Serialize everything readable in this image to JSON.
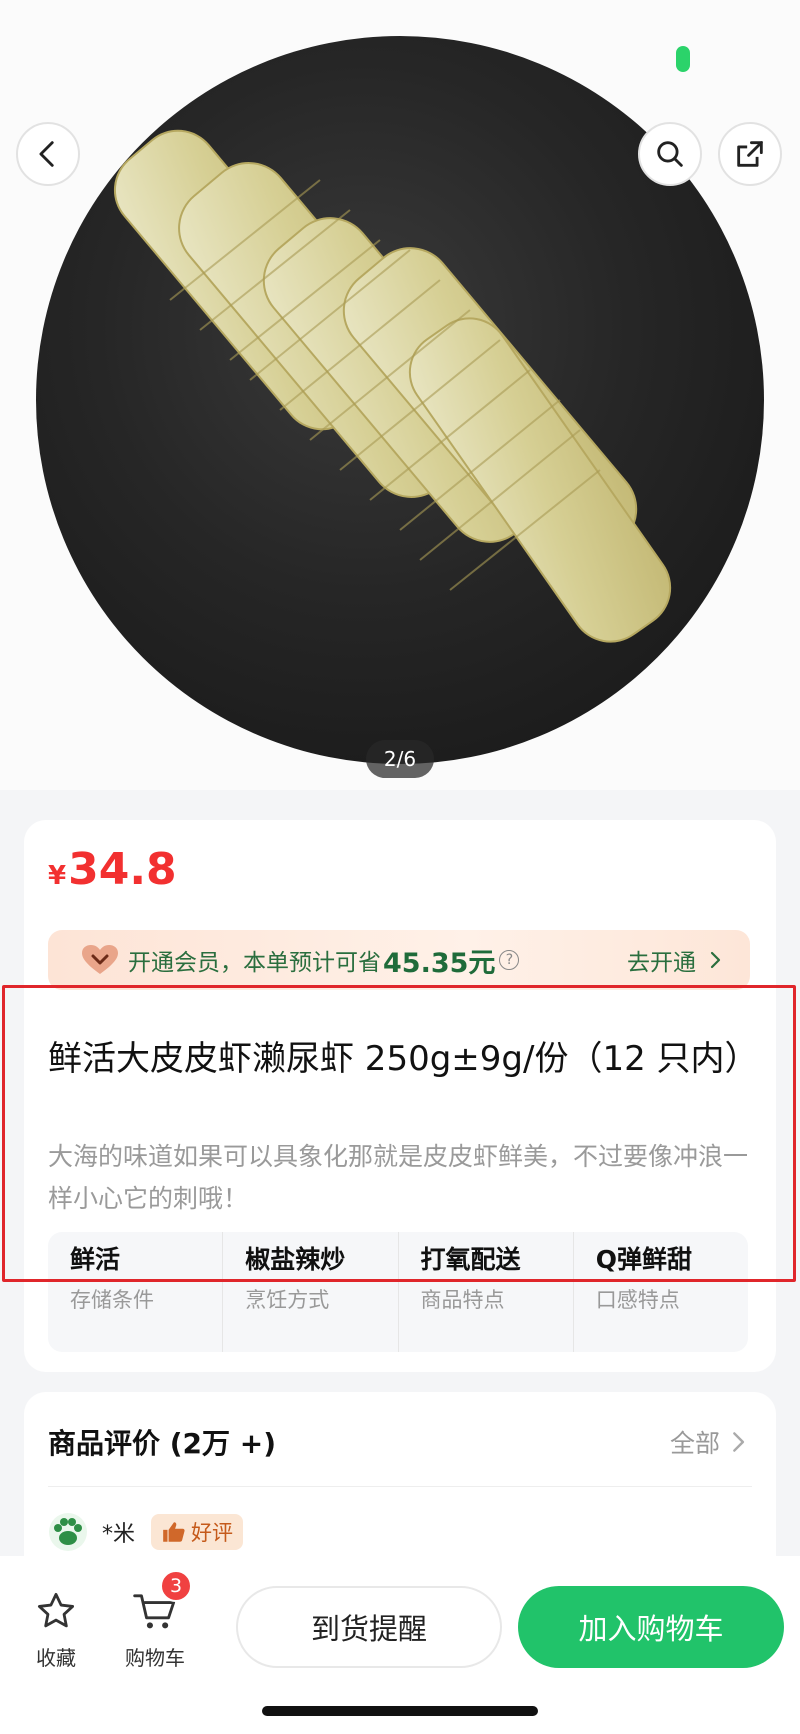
{
  "image": {
    "pager": "2/6"
  },
  "price": {
    "currency": "¥",
    "value": "34.8"
  },
  "member_banner": {
    "text": "开通会员，本单预计可省",
    "amount": "45.35元",
    "cta": "去开通"
  },
  "product": {
    "title": "鲜活大皮皮虾濑尿虾 250g±9g/份（12 只内）",
    "description": "大海的味道如果可以具象化那就是皮皮虾鲜美，不过要像冲浪一样小心它的刺哦！",
    "attributes": [
      {
        "value": "鲜活",
        "label": "存储条件"
      },
      {
        "value": "椒盐辣炒",
        "label": "烹饪方式"
      },
      {
        "value": "打氧配送",
        "label": "商品特点"
      },
      {
        "value": "Q弹鲜甜",
        "label": "口感特点"
      }
    ]
  },
  "reviews": {
    "title": "商品评价 (2万 +)",
    "all_label": "全部",
    "first": {
      "user": "*米",
      "badge": "好评"
    }
  },
  "bottom_bar": {
    "favorite_label": "收藏",
    "cart_label": "购物车",
    "cart_count": "3",
    "remind_label": "到货提醒",
    "add_cart_label": "加入购物车"
  },
  "colors": {
    "price": "#f23030",
    "accent_green": "#21c36a",
    "highlight_box": "#e0262b"
  },
  "icons": [
    "back-icon",
    "search-icon",
    "share-icon",
    "heart-icon",
    "help-icon",
    "chevron-right-icon",
    "paw-avatar-icon",
    "thumbs-up-icon",
    "star-icon",
    "cart-icon"
  ]
}
